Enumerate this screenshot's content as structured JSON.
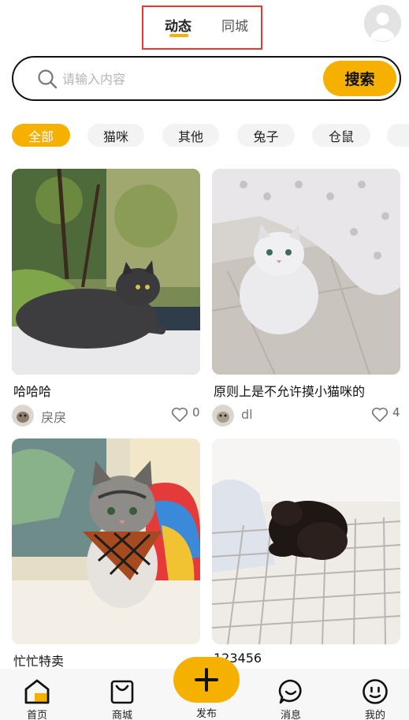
{
  "header": {
    "tabs": [
      {
        "label": "动态",
        "active": true
      },
      {
        "label": "同城",
        "active": false
      }
    ],
    "avatar_icon": "user-avatar-icon"
  },
  "search": {
    "placeholder": "请输入内容",
    "value": "",
    "button_label": "搜索"
  },
  "categories": [
    "全部",
    "猫咪",
    "其他",
    "兔子",
    "仓鼠"
  ],
  "selected_category": "全部",
  "posts": [
    {
      "title": "哈哈哈",
      "user": "戾戾",
      "likes": "0",
      "image": "gray-long-hair-cat"
    },
    {
      "title": "原则上是不允许摸小猫咪的",
      "user": "dl",
      "likes": "4",
      "image": "silver-persian-cat"
    },
    {
      "title": "忙忙特卖",
      "user": "",
      "likes": "",
      "image": "tabby-cat-with-scarf"
    },
    {
      "title": "123456",
      "user": "",
      "likes": "",
      "image": "black-puppy"
    }
  ],
  "bottom_nav": [
    {
      "label": "首页",
      "icon": "home-icon",
      "active": true
    },
    {
      "label": "商城",
      "icon": "shopping-bag-icon",
      "active": false
    },
    {
      "label": "发布",
      "icon": "plus-icon",
      "active": false
    },
    {
      "label": "消息",
      "icon": "chat-bubble-icon",
      "active": false
    },
    {
      "label": "我的",
      "icon": "smiley-profile-icon",
      "active": false
    }
  ],
  "colors": {
    "accent": "#f6b100",
    "highlight_border": "#e53935"
  }
}
